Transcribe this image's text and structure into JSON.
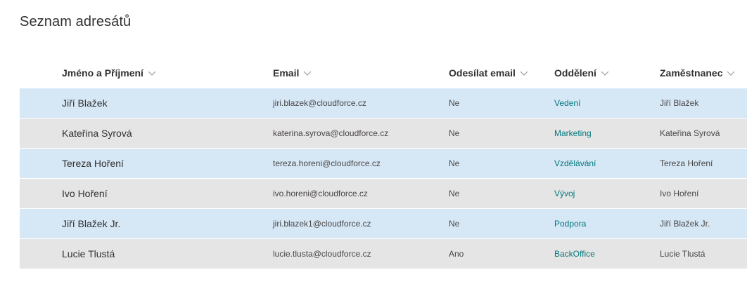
{
  "page": {
    "title": "Seznam adresátů"
  },
  "columns": {
    "name": "Jméno a Příjmení",
    "email": "Email",
    "send": "Odesílat email",
    "dept": "Oddělení",
    "employee": "Zaměstnanec"
  },
  "rows": [
    {
      "name": "Jiří Blažek",
      "email": "jiri.blazek@cloudforce.cz",
      "send": "Ne",
      "dept": "Vedení",
      "employee": "Jiří Blažek"
    },
    {
      "name": "Kateřina Syrová",
      "email": "katerina.syrova@cloudforce.cz",
      "send": "Ne",
      "dept": "Marketing",
      "employee": "Kateřina Syrová"
    },
    {
      "name": "Tereza Hoření",
      "email": "tereza.horeni@cloudforce.cz",
      "send": "Ne",
      "dept": "Vzdělávání",
      "employee": "Tereza Hoření"
    },
    {
      "name": "Ivo Hoření",
      "email": "ivo.horeni@cloudforce.cz",
      "send": "Ne",
      "dept": "Vývoj",
      "employee": "Ivo Hoření"
    },
    {
      "name": "Jiří Blažek Jr.",
      "email": "jiri.blazek1@cloudforce.cz",
      "send": "Ne",
      "dept": "Podpora",
      "employee": "Jiří Blažek Jr."
    },
    {
      "name": "Lucie Tlustá",
      "email": "lucie.tlusta@cloudforce.cz",
      "send": "Ano",
      "dept": "BackOffice",
      "employee": "Lucie Tlustá"
    }
  ],
  "colors": {
    "row_selected": "#d6e7f6",
    "row_alt": "#e6e5e5",
    "link": "#03787c"
  },
  "icons": {
    "column_sort": "chevron-down-icon"
  }
}
